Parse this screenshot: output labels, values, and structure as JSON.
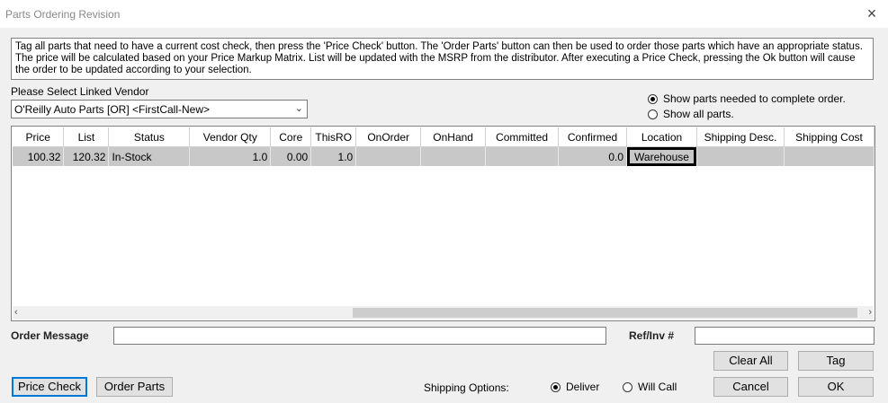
{
  "window": {
    "title": "Parts Ordering Revision",
    "close_glyph": "×"
  },
  "info_text": "Tag all parts that need to have a current cost check, then press the 'Price Check' button.  The 'Order Parts' button can then be used to order those parts which have an appropriate status.  The price will be calculated based on your Price Markup Matrix. List will be updated with the MSRP from the distributor.  After executing a Price Check, pressing the Ok button will cause the order to be updated according to your selection.",
  "vendor": {
    "label": "Please Select Linked Vendor",
    "selected": "O'Reilly Auto Parts [OR] <FirstCall-New>"
  },
  "filter": {
    "option1": "Show parts needed to complete order.",
    "option2": "Show all parts.",
    "selected": "option1"
  },
  "grid": {
    "columns": [
      "Price",
      "List",
      "Status",
      "Vendor Qty",
      "Core",
      "ThisRO",
      "OnOrder",
      "OnHand",
      "Committed",
      "Confirmed",
      "Location",
      "Shipping Desc.",
      "Shipping Cost"
    ],
    "rows": [
      [
        "100.32",
        "120.32",
        "In-Stock",
        "1.0",
        "0.00",
        "1.0",
        "",
        "",
        "",
        "0.0",
        "Warehouse",
        "",
        ""
      ]
    ]
  },
  "order_message": {
    "label": "Order Message",
    "value": ""
  },
  "ref_inv": {
    "label": "Ref/Inv #",
    "value": ""
  },
  "buttons": {
    "clear_all": "Clear All",
    "tag": "Tag",
    "price_check": "Price Check",
    "order_parts": "Order Parts",
    "cancel": "Cancel",
    "ok": "OK"
  },
  "shipping": {
    "label": "Shipping Options:",
    "deliver": "Deliver",
    "will_call": "Will Call",
    "selected": "deliver"
  },
  "icons": {
    "dropdown": "chevron-down-icon",
    "scroll_left": "arrow-left-icon",
    "scroll_right": "arrow-right-icon"
  }
}
